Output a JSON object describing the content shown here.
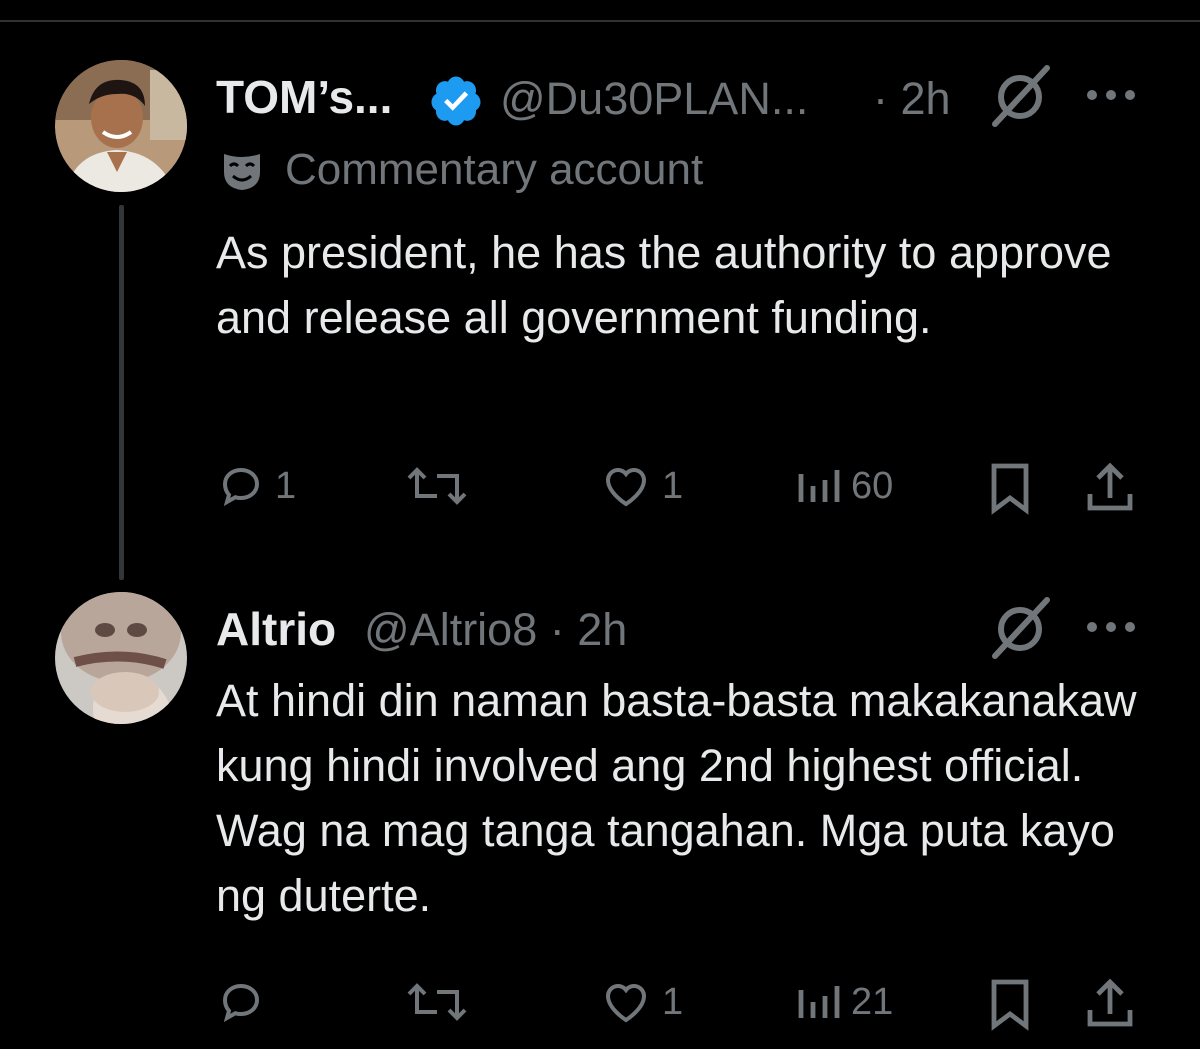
{
  "tweets": [
    {
      "display_name": "TOM’s...",
      "handle": "@Du30PLAN...",
      "time": "· 2h",
      "label": "Commentary account",
      "text": "As president, he has the authority to approve and release all government funding.",
      "stats": {
        "replies": "1",
        "retweets": "",
        "likes": "1",
        "views": "60"
      }
    },
    {
      "display_name": "Altrio",
      "handle": "@Altrio8 · 2h",
      "text": "At hindi din naman basta-basta makakanakaw kung hindi involved ang 2nd highest official. Wag na mag tanga tangahan. Mga puta kayo ng duterte.",
      "stats": {
        "replies": "",
        "retweets": "",
        "likes": "1",
        "views": "21"
      }
    }
  ],
  "colors": {
    "background": "#000000",
    "primary_text": "#e7e9ea",
    "secondary_text": "#71767b",
    "verified": "#1d9bf0",
    "divider": "#2f3336"
  }
}
